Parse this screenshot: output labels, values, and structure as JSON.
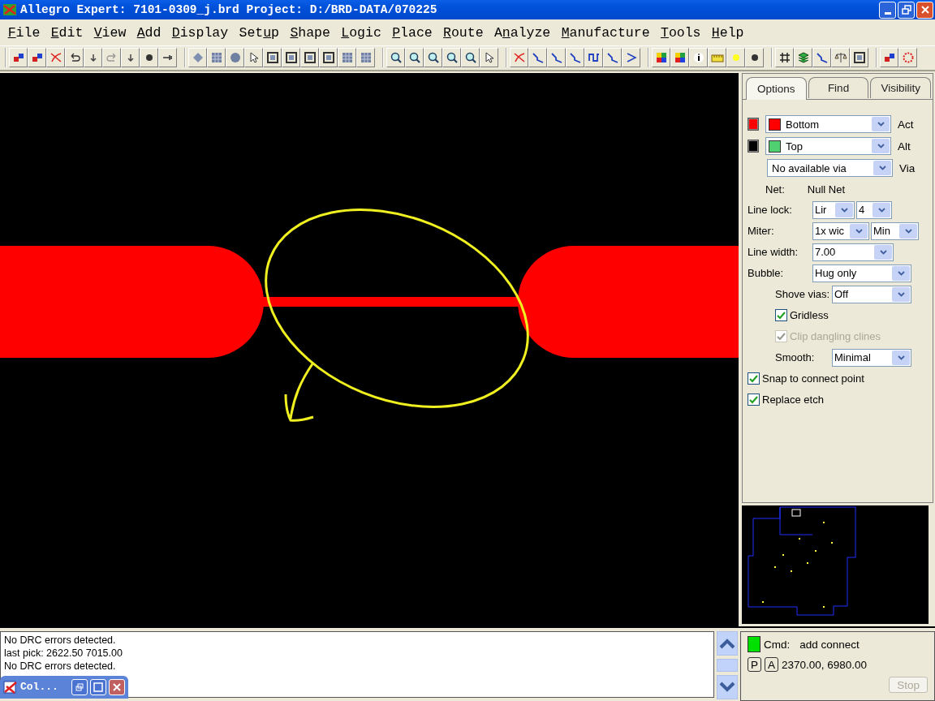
{
  "window": {
    "title": "Allegro Expert: 7101-0309_j.brd  Project: D:/BRD-DATA/070225"
  },
  "menu": [
    {
      "key": "F",
      "post": "ile"
    },
    {
      "key": "E",
      "post": "dit"
    },
    {
      "key": "V",
      "post": "iew"
    },
    {
      "key": "A",
      "post": "dd"
    },
    {
      "key": "D",
      "post": "isplay"
    },
    {
      "pre": "Set",
      "key": "u",
      "post": "p"
    },
    {
      "key": "S",
      "post": "hape"
    },
    {
      "key": "L",
      "post": "ogic"
    },
    {
      "key": "P",
      "post": "lace"
    },
    {
      "key": "R",
      "post": "oute"
    },
    {
      "pre": "A",
      "key": "n",
      "post": "alyze"
    },
    {
      "key": "M",
      "post": "anufacture"
    },
    {
      "key": "T",
      "post": "ools"
    },
    {
      "key": "H",
      "post": "elp"
    }
  ],
  "tabs": [
    {
      "label": "Options",
      "selected": true
    },
    {
      "label": "Find",
      "selected": false
    },
    {
      "label": "Visibility",
      "selected": false
    }
  ],
  "layers": [
    {
      "indicator": {
        "color": "#ff0000"
      },
      "color": "#ff0000",
      "name": "Bottom",
      "role": "Act"
    },
    {
      "indicator": {
        "color": "#000000"
      },
      "color": "#50d070",
      "name": "Top",
      "role": "Alt"
    }
  ],
  "via": {
    "value": "No available via",
    "role": "Via"
  },
  "net": {
    "label": "Net:",
    "value": "Null Net"
  },
  "options": [
    {
      "kind": "dropdown",
      "label": "Line lock:",
      "indented": false,
      "values": [
        "Lir",
        "4"
      ]
    },
    {
      "kind": "dropdown",
      "label": "Miter:",
      "indented": false,
      "values": [
        "1x wic",
        "Min"
      ]
    },
    {
      "kind": "dropdown",
      "label": "Line width:",
      "indented": false,
      "values": [
        "7.00"
      ]
    },
    {
      "kind": "dropdown",
      "label": "Bubble:",
      "indented": false,
      "values": [
        "Hug only"
      ]
    },
    {
      "kind": "dropdown",
      "label": "Shove vias:",
      "indented": true,
      "values": [
        "Off"
      ]
    },
    {
      "kind": "checkbox",
      "label": "Gridless",
      "indented": true,
      "checked": true,
      "disabled": false
    },
    {
      "kind": "checkbox",
      "label": "Clip dangling clines",
      "indented": true,
      "checked": true,
      "disabled": true
    },
    {
      "kind": "dropdown",
      "label": "Smooth:",
      "indented": true,
      "values": [
        "Minimal"
      ]
    },
    {
      "kind": "checkbox",
      "label": "Snap to connect point",
      "indented": false,
      "checked": true,
      "disabled": false
    },
    {
      "kind": "checkbox",
      "label": "Replace etch",
      "indented": false,
      "checked": true,
      "disabled": false
    }
  ],
  "console": [
    "No DRC errors detected.",
    "last pick:  2622.50  7015.00",
    "No DRC errors detected."
  ],
  "status": {
    "indicator": {
      "color": "#00e000"
    },
    "label": "Cmd:",
    "command": "add connect",
    "modes": [
      "P",
      "A"
    ],
    "coords": "2370.00, 6980.00",
    "stop": {
      "label": "Stop",
      "disabled": true
    }
  },
  "minimized_window": {
    "title": "Col..."
  }
}
